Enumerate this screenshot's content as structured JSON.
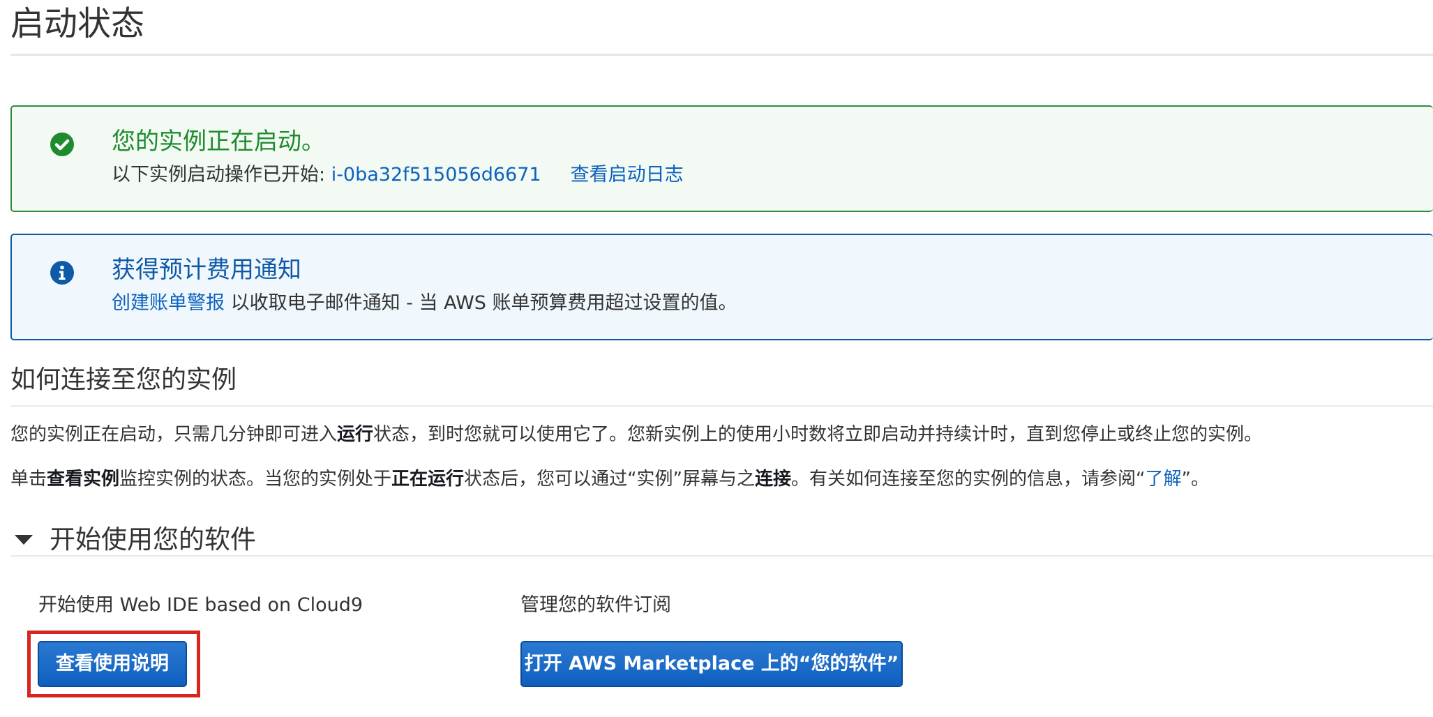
{
  "page": {
    "title": "启动状态"
  },
  "success_alert": {
    "heading": "您的实例正在启动。",
    "body_prefix": "以下实例启动操作已开始: ",
    "instance_id": "i-0ba32f515056d6671",
    "view_log_link": "查看启动日志",
    "icon": "check-circle-icon",
    "color": "#1f8b2e"
  },
  "info_alert": {
    "heading": "获得预计费用通知",
    "link": "创建账单警报",
    "body_suffix": " 以收取电子邮件通知 - 当 AWS 账单预算费用超过设置的值。",
    "icon": "info-circle-icon",
    "color": "#0f5aa8"
  },
  "connect_section": {
    "title": "如何连接至您的实例",
    "p1": {
      "part1": "您的实例正在启动，只需几分钟即可进入",
      "bold1": "运行",
      "part2": "状态，到时您就可以使用它了。您新实例上的使用小时数将立即启动并持续计时，直到您停止或终止您的实例。"
    },
    "p2": {
      "part1": "单击",
      "bold1": "查看实例",
      "part2": "监控实例的状态。当您的实例处于",
      "bold2": "正在运行",
      "part3": "状态后，您可以通过“实例”屏幕与之",
      "bold3": "连接",
      "part4": "。有关如何连接至您的实例的信息，请参阅“",
      "link": "了解",
      "part5": "”。"
    }
  },
  "software_section": {
    "toggle_label": "开始使用您的软件",
    "left_label": "开始使用 Web IDE based on Cloud9",
    "left_button": "查看使用说明",
    "right_label": "管理您的软件订阅",
    "right_button": "打开 AWS Marketplace 上的“您的软件”"
  },
  "colors": {
    "link": "#0d62bd",
    "button": "#0f5fbf",
    "highlight": "#d6261e"
  }
}
